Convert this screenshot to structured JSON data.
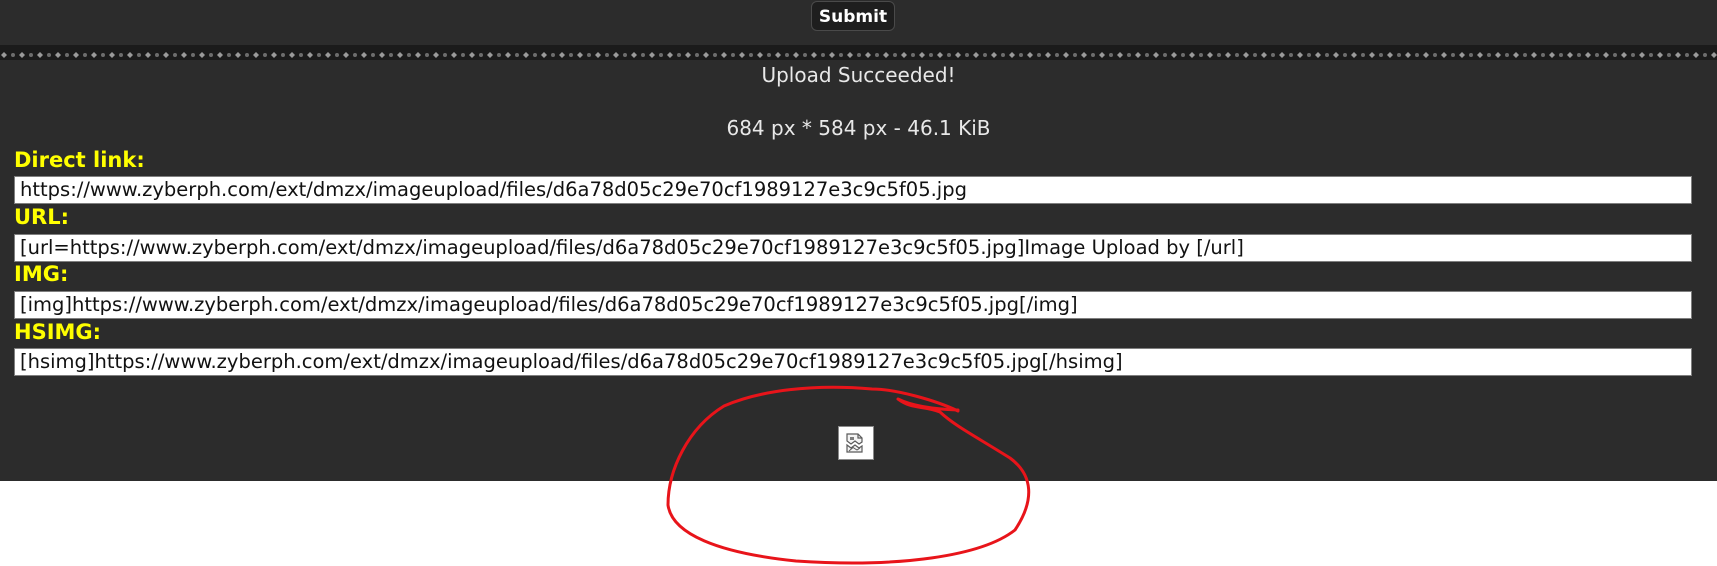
{
  "submit_label": "Submit",
  "status": {
    "title": "Upload Succeeded!",
    "dimensions": "684 px * 584 px - 46.1 KiB"
  },
  "fields": [
    {
      "label": "Direct link:",
      "value": "https://www.zyberph.com/ext/dmzx/imageupload/files/d6a78d05c29e70cf1989127e3c9c5f05.jpg"
    },
    {
      "label": "URL:",
      "value": "[url=https://www.zyberph.com/ext/dmzx/imageupload/files/d6a78d05c29e70cf1989127e3c9c5f05.jpg]Image Upload by [/url]"
    },
    {
      "label": "IMG:",
      "value": "[img]https://www.zyberph.com/ext/dmzx/imageupload/files/d6a78d05c29e70cf1989127e3c9c5f05.jpg[/img]"
    },
    {
      "label": "HSIMG:",
      "value": "[hsimg]https://www.zyberph.com/ext/dmzx/imageupload/files/d6a78d05c29e70cf1989127e3c9c5f05.jpg[/hsimg]"
    }
  ],
  "preview": {
    "icon": "broken-image-icon"
  },
  "annotation": {
    "color": "#e8141a"
  },
  "colors": {
    "panel": "#2c2c2c",
    "label": "#ffff00"
  }
}
